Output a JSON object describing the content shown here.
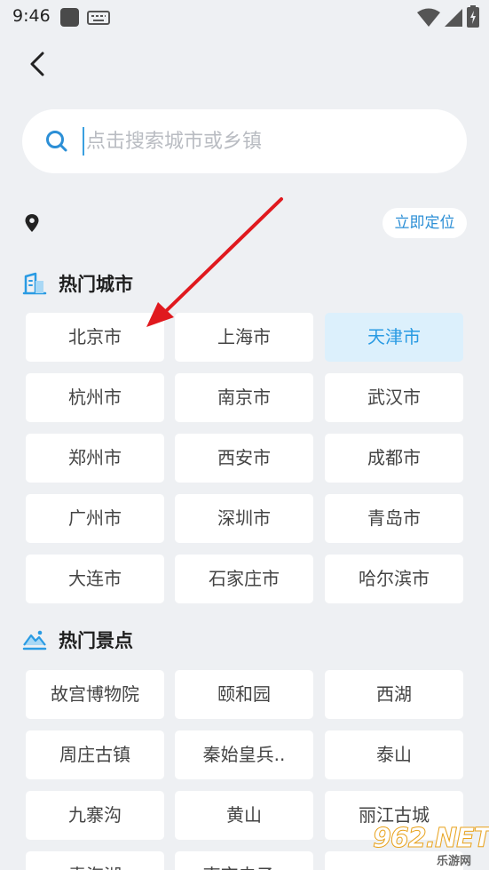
{
  "status_bar": {
    "time": "9:46",
    "icons": [
      "app-icon",
      "keyboard-icon",
      "wifi-icon",
      "signal-icon",
      "battery-icon"
    ]
  },
  "navigation": {
    "back_icon": "chevron-left-icon"
  },
  "search": {
    "placeholder": "点击搜索城市或乡镇",
    "value": "",
    "icon": "search-icon"
  },
  "location": {
    "icon": "location-pin-icon",
    "locate_label": "立即定位"
  },
  "hot_cities": {
    "title": "热门城市",
    "icon": "building-icon",
    "selected": "天津市",
    "items": [
      "北京市",
      "上海市",
      "天津市",
      "杭州市",
      "南京市",
      "武汉市",
      "郑州市",
      "西安市",
      "成都市",
      "广州市",
      "深圳市",
      "青岛市",
      "大连市",
      "石家庄市",
      "哈尔滨市"
    ]
  },
  "hot_spots": {
    "title": "热门景点",
    "icon": "mountain-icon",
    "items": [
      "故宫博物院",
      "颐和园",
      "西湖",
      "周庄古镇",
      "秦始皇兵..",
      "泰山",
      "九寨沟",
      "黄山",
      "丽江古城",
      "青海湖",
      "南京夫子..",
      ""
    ]
  },
  "annotation": {
    "type": "red-arrow",
    "target": "北京市"
  },
  "watermark": {
    "logo": "962.NET",
    "sub": "乐游网"
  },
  "colors": {
    "background": "#eef0f3",
    "accent": "#2a9be3",
    "selected_bg": "#dcf0fc",
    "arrow": "#e0191e"
  }
}
